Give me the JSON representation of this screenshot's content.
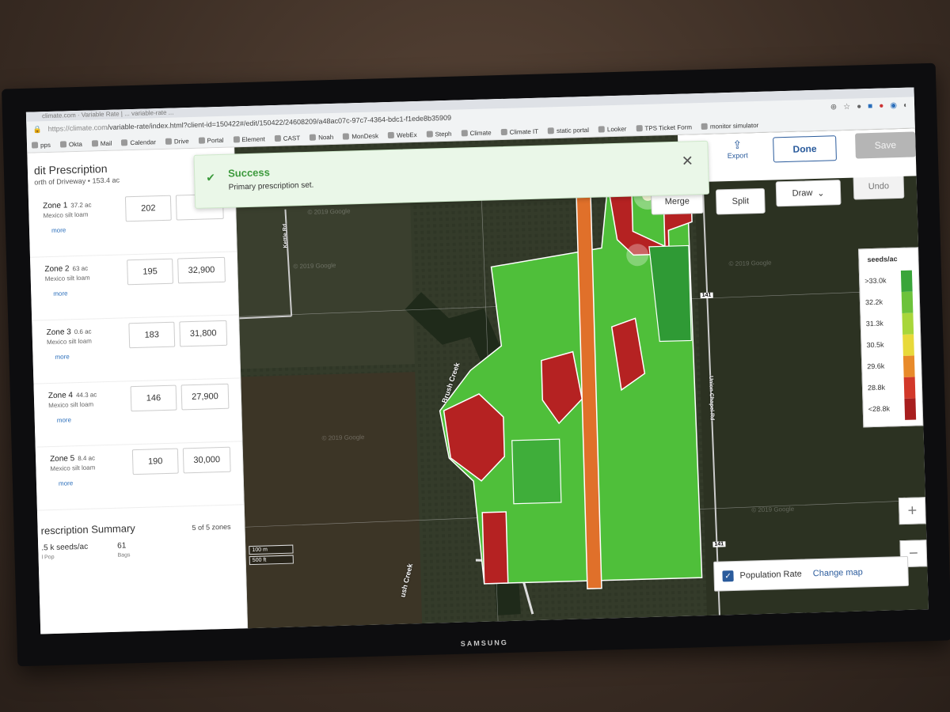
{
  "monitor": {
    "brand": "SAMSUNG"
  },
  "browser": {
    "tab_text": "climate.com · Variable Rate   |   ... variable-rate ...",
    "url_host": "https://climate.com",
    "url_path": "/variable-rate/index.html?client-id=150422#/edit/150422/24608209/a48ac07c-97c7-4364-bdc1-f1ede8b35909",
    "bookmarks": [
      "pps",
      "Okta",
      "Mail",
      "Calendar",
      "Drive",
      "Portal",
      "Element",
      "CAST",
      "Noah",
      "MonDesk",
      "WebEx",
      "Steph",
      "Climate",
      "Climate IT",
      "static portal",
      "Looker",
      "TPS Ticket Form",
      "monitor simulator"
    ]
  },
  "header": {
    "title": "dit Prescription",
    "subtitle": "orth of Driveway • 153.4 ac",
    "export_label": "Export",
    "done_label": "Done",
    "save_label": "Save"
  },
  "zones": [
    {
      "name": "Zone 1",
      "acres": "37.2 ac",
      "soil": "Mexico silt loam",
      "more": "more",
      "rate1": "202",
      "rate2": ""
    },
    {
      "name": "Zone 2",
      "acres": "63 ac",
      "soil": "Mexico silt loam",
      "more": "more",
      "rate1": "195",
      "rate2": "32,900"
    },
    {
      "name": "Zone 3",
      "acres": "0.6 ac",
      "soil": "Mexico silt loam",
      "more": "more",
      "rate1": "183",
      "rate2": "31,800"
    },
    {
      "name": "Zone 4",
      "acres": "44.3 ac",
      "soil": "Mexico silt loam",
      "more": "more",
      "rate1": "146",
      "rate2": "27,900"
    },
    {
      "name": "Zone 5",
      "acres": "8.4 ac",
      "soil": "Mexico silt loam",
      "more": "more",
      "rate1": "190",
      "rate2": "30,000"
    }
  ],
  "summary": {
    "title": "rescription Summary",
    "count": "5 of 5 zones",
    "avg_value": ".5 k seeds/ac",
    "avg_label": "l Pop",
    "bags_value": "61",
    "bags_label": "Bags"
  },
  "toast": {
    "title": "Success",
    "message": "Primary prescription set."
  },
  "tools": {
    "merge": "Merge",
    "split": "Split",
    "draw": "Draw",
    "undo": "Undo"
  },
  "legend": {
    "title": "seeds/ac",
    "items": [
      {
        "label": ">33.0k",
        "color": "#3aa53a"
      },
      {
        "label": "32.2k",
        "color": "#6cc23a"
      },
      {
        "label": "31.3k",
        "color": "#a8d63a"
      },
      {
        "label": "30.5k",
        "color": "#e8d93a"
      },
      {
        "label": "29.6k",
        "color": "#e88a2a"
      },
      {
        "label": "28.8k",
        "color": "#d2382a"
      },
      {
        "label": "<28.8k",
        "color": "#a81e1e"
      }
    ]
  },
  "map": {
    "watermark": "© 2019 Google",
    "creek_label_1": "Brush Creek",
    "creek_label_2": "ush Creek",
    "road_label_1": "Kettle Rd",
    "road_label_2": "Union Chapel Rd",
    "road_label_3": "141",
    "scale_m": "100 m",
    "scale_ft": "500 ft",
    "zoom_in": "+",
    "zoom_out": "−"
  },
  "layer": {
    "label": "Population Rate",
    "change": "Change map",
    "checked": true
  }
}
